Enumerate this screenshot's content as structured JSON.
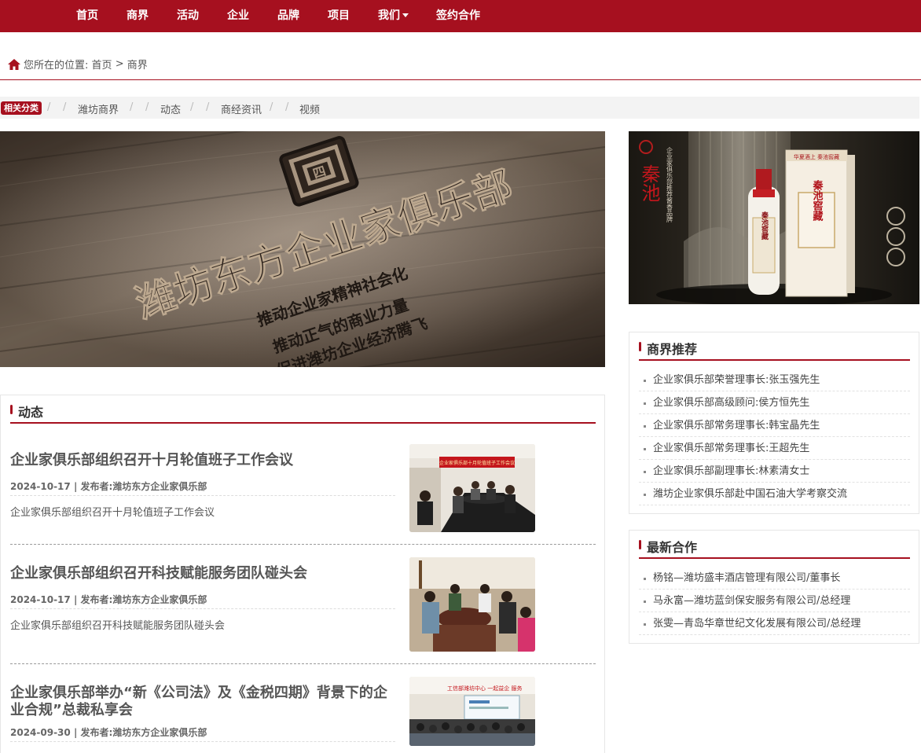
{
  "nav": {
    "items": [
      "首页",
      "商界",
      "活动",
      "企业",
      "品牌",
      "项目",
      "我们",
      "签约合作"
    ]
  },
  "breadcrumb": {
    "prefix": "您所在的位置:",
    "home": "首页",
    "separator": ">",
    "current": "商界"
  },
  "categories": {
    "badge": "相关分类",
    "items": [
      "潍坊商界",
      "动态",
      "商经资讯",
      "视频"
    ]
  },
  "banner": {
    "logo_text": "四",
    "title": "潍坊东方企业家俱乐部",
    "lines": [
      "推动企业家精神社会化",
      "推动正气的商业力量",
      "促进潍坊企业经济腾飞"
    ]
  },
  "side_ad": {
    "brand": "秦池",
    "vertical_text": "企业家俱乐部推荐酱香品牌",
    "box_text": "秦池窖藏",
    "box_label": "华夏酒上 秦池窖藏",
    "bottle_label": "秦池窖藏"
  },
  "dynamic": {
    "title": "动态",
    "items": [
      {
        "title": "企业家俱乐部组织召开十月轮值班子工作会议",
        "date": "2024-10-17",
        "publisher": "发布者:潍坊东方企业家俱乐部",
        "summary": "企业家俱乐部组织召开十月轮值班子工作会议",
        "thumb_banner": "企业家俱乐部十月轮值班子工作会议"
      },
      {
        "title": "企业家俱乐部组织召开科技赋能服务团队碰头会",
        "date": "2024-10-17",
        "publisher": "发布者:潍坊东方企业家俱乐部",
        "summary": "企业家俱乐部组织召开科技赋能服务团队碰头会"
      },
      {
        "title": "企业家俱乐部举办“新《公司法》及《金税四期》背景下的企业合规”总裁私享会",
        "date": "2024-09-30",
        "publisher": "发布者:潍坊东方企业家俱乐部",
        "thumb_banner": "工信部潍坊中心 一起益企 服务"
      }
    ]
  },
  "recommend": {
    "title": "商界推荐",
    "items": [
      "企业家俱乐部荣誉理事长:张玉强先生",
      "企业家俱乐部高级顾问:侯方恒先生",
      "企业家俱乐部常务理事长:韩宝晶先生",
      "企业家俱乐部常务理事长:王超先生",
      "企业家俱乐部副理事长:林素清女士",
      "潍坊企业家俱乐部赴中国石油大学考察交流"
    ]
  },
  "cooperation": {
    "title": "最新合作",
    "items": [
      "杨铭—潍坊盛丰酒店管理有限公司/董事长",
      "马永富—潍坊蓝剑保安服务有限公司/总经理",
      "张雯—青岛华章世纪文化发展有限公司/总经理"
    ]
  },
  "colors": {
    "brand": "#a6101f",
    "text": "#333333",
    "muted": "#666666"
  },
  "icons": [
    "home-icon",
    "chevron-down-icon"
  ]
}
